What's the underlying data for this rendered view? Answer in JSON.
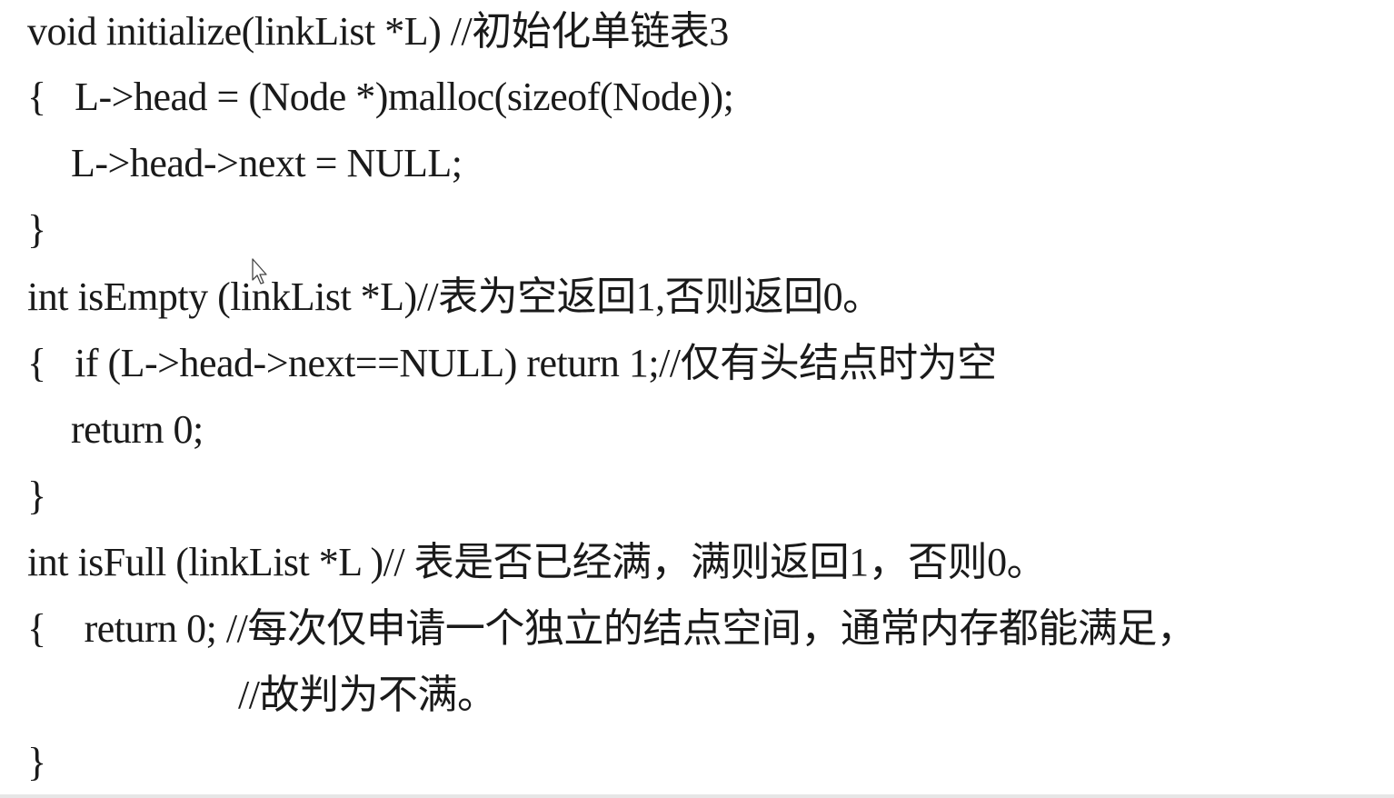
{
  "code": {
    "lines": [
      "void initialize(linkList *L) //初始化单链表3",
      "{   L->head = (Node *)malloc(sizeof(Node));",
      "L->head->next = NULL;",
      "}",
      "int isEmpty (linkList *L)//表为空返回1,否则返回0。",
      "{   if (L->head->next==NULL) return 1;//仅有头结点时为空",
      "return 0;",
      "}",
      "int isFull (linkList *L )// 表是否已经满，满则返回1，否则0。",
      "{    return 0; //每次仅申请一个独立的结点空间，通常内存都能满足，",
      "//故判为不满。",
      "}"
    ]
  }
}
